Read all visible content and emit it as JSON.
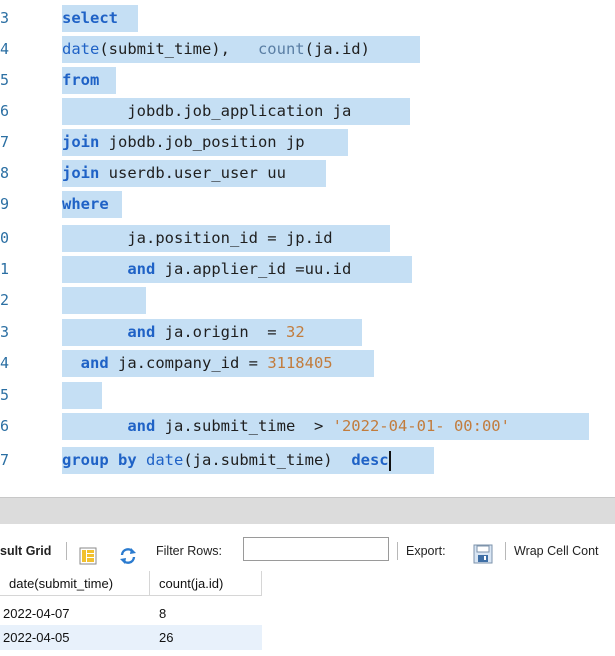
{
  "editor": {
    "lines": [
      {
        "num": "3"
      },
      {
        "num": "4"
      },
      {
        "num": "5"
      },
      {
        "num": "6"
      },
      {
        "num": "7"
      },
      {
        "num": "8"
      },
      {
        "num": "9"
      },
      {
        "num": "0"
      },
      {
        "num": "1"
      },
      {
        "num": "2"
      },
      {
        "num": "3"
      },
      {
        "num": "4"
      },
      {
        "num": "5"
      },
      {
        "num": "6"
      },
      {
        "num": "7"
      }
    ],
    "tokens": {
      "l3_select": "select",
      "l4_date": "date",
      "l4_args": "(submit_time),   ",
      "l4_count": "count",
      "l4_countargs": "(ja.id)",
      "l5_from": "from",
      "l6_table": "       jobdb.job_application ja",
      "l7_join": "join",
      "l7_rest": " jobdb.job_position jp",
      "l8_join": "join",
      "l8_rest": " userdb.user_user uu",
      "l9_where": "where",
      "l10_cond": "       ja.position_id = jp.id",
      "l11_and": "       and",
      "l11_rest": " ja.applier_id =uu.id",
      "l12_blank": "       ",
      "l13_and": "       and",
      "l13_rest": " ja.origin  = ",
      "l13_num": "32",
      "l14_and": "  and",
      "l14_rest": " ja.company_id = ",
      "l14_num": "3118405",
      "l15_blank": "       ",
      "l16_and": "       and",
      "l16_rest": " ja.submit_time  > ",
      "l16_str": "'2022-04-01- 00:00'",
      "l17_groupby": "group by",
      "l17_sp": " ",
      "l17_date": "date",
      "l17_rest": "(ja.submit_time)  ",
      "l17_desc": "desc"
    }
  },
  "toolbar": {
    "result_grid_label": "sult Grid",
    "filter_rows_label": "Filter Rows:",
    "filter_value": "",
    "export_label": "Export:",
    "wrap_label": "Wrap Cell Cont"
  },
  "grid": {
    "columns": [
      "date(submit_time)",
      "count(ja.id)"
    ],
    "rows": [
      [
        "2022-04-07",
        "8"
      ],
      [
        "2022-04-05",
        "26"
      ]
    ]
  },
  "colors": {
    "selection": "#c5dff4",
    "keyword": "#1f62c6",
    "number": "#c27c3d",
    "line_number": "#2b6fa3",
    "row_alt": "#e8f1fb"
  }
}
